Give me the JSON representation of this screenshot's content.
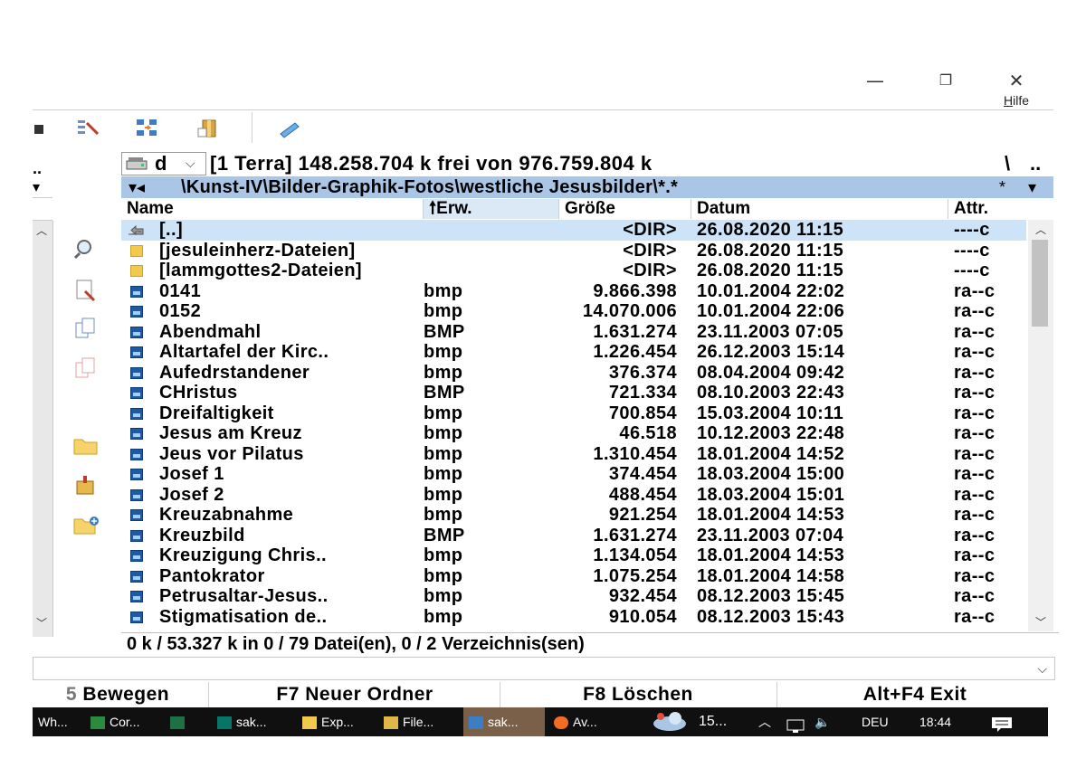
{
  "window": {
    "controls": {
      "minimize": "—",
      "restore": "❐",
      "close": "✕"
    },
    "menu_help": "Hilfe"
  },
  "toolbar": {
    "icons": [
      "toolbar-icon-partial",
      "multi-rename-icon",
      "sync-dirs-icon",
      "pack-files-icon",
      "notepad-icon"
    ]
  },
  "drive": {
    "letter": "d",
    "info": "[1 Terra]  148.258.704 k frei von 976.759.804 k",
    "root": "\\",
    "up": ".."
  },
  "path": {
    "arrows": "▾◂",
    "text": "\\Kunst-IV\\Bilder-Graphik-Fotos\\westliche Jesusbilder\\*.*",
    "star": "*",
    "dropdown": "▾"
  },
  "columns": {
    "name": "Name",
    "ext": "Erw.",
    "ext_sort": "🠕",
    "size": "Größe",
    "date": "Datum",
    "attr": "Attr."
  },
  "files": [
    {
      "name": "[..]",
      "ext": "",
      "size": "<DIR>",
      "date": "26.08.2020 11:15",
      "attr": "----c",
      "type": "up",
      "selected": true
    },
    {
      "name": "[jesuleinherz-Dateien]",
      "ext": "",
      "size": "<DIR>",
      "date": "26.08.2020 11:15",
      "attr": "----c",
      "type": "dir"
    },
    {
      "name": "[lammgottes2-Dateien]",
      "ext": "",
      "size": "<DIR>",
      "date": "26.08.2020 11:15",
      "attr": "----c",
      "type": "dir"
    },
    {
      "name": "0141",
      "ext": "bmp",
      "size": "9.866.398",
      "date": "10.01.2004 22:02",
      "attr": "ra--c",
      "type": "img"
    },
    {
      "name": "0152",
      "ext": "bmp",
      "size": "14.070.006",
      "date": "10.01.2004 22:06",
      "attr": "ra--c",
      "type": "img"
    },
    {
      "name": "Abendmahl",
      "ext": "BMP",
      "size": "1.631.274",
      "date": "23.11.2003 07:05",
      "attr": "ra--c",
      "type": "img"
    },
    {
      "name": "Altartafel der Kirc..",
      "ext": "bmp",
      "size": "1.226.454",
      "date": "26.12.2003 15:14",
      "attr": "ra--c",
      "type": "img"
    },
    {
      "name": "Aufedrstandener",
      "ext": "bmp",
      "size": "376.374",
      "date": "08.04.2004 09:42",
      "attr": "ra--c",
      "type": "img"
    },
    {
      "name": "CHristus",
      "ext": "BMP",
      "size": "721.334",
      "date": "08.10.2003 22:43",
      "attr": "ra--c",
      "type": "img"
    },
    {
      "name": "Dreifaltigkeit",
      "ext": "bmp",
      "size": "700.854",
      "date": "15.03.2004 10:11",
      "attr": "ra--c",
      "type": "img"
    },
    {
      "name": "Jesus am Kreuz",
      "ext": "bmp",
      "size": "46.518",
      "date": "10.12.2003 22:48",
      "attr": "ra--c",
      "type": "img"
    },
    {
      "name": "Jeus vor Pilatus",
      "ext": "bmp",
      "size": "1.310.454",
      "date": "18.01.2004 14:52",
      "attr": "ra--c",
      "type": "img"
    },
    {
      "name": "Josef 1",
      "ext": "bmp",
      "size": "374.454",
      "date": "18.03.2004 15:00",
      "attr": "ra--c",
      "type": "img"
    },
    {
      "name": "Josef 2",
      "ext": "bmp",
      "size": "488.454",
      "date": "18.03.2004 15:01",
      "attr": "ra--c",
      "type": "img"
    },
    {
      "name": "Kreuzabnahme",
      "ext": "bmp",
      "size": "921.254",
      "date": "18.01.2004 14:53",
      "attr": "ra--c",
      "type": "img"
    },
    {
      "name": "Kreuzbild",
      "ext": "BMP",
      "size": "1.631.274",
      "date": "23.11.2003 07:04",
      "attr": "ra--c",
      "type": "img"
    },
    {
      "name": "Kreuzigung Chris..",
      "ext": "bmp",
      "size": "1.134.054",
      "date": "18.01.2004 14:53",
      "attr": "ra--c",
      "type": "img"
    },
    {
      "name": "Pantokrator",
      "ext": "bmp",
      "size": "1.075.254",
      "date": "18.01.2004 14:58",
      "attr": "ra--c",
      "type": "img"
    },
    {
      "name": "Petrusaltar-Jesus..",
      "ext": "bmp",
      "size": "932.454",
      "date": "08.12.2003 15:45",
      "attr": "ra--c",
      "type": "img"
    },
    {
      "name": "Stigmatisation de..",
      "ext": "bmp",
      "size": "910.054",
      "date": "08.12.2003 15:43",
      "attr": "ra--c",
      "type": "img"
    }
  ],
  "status": "0 k / 53.327 k in 0 / 79 Datei(en), 0 / 2 Verzeichnis(sen)",
  "fkeys": [
    "Bewegen",
    "F7 Neuer Ordner",
    "F8 Löschen",
    "Alt+F4 Exit"
  ],
  "taskbar": {
    "items": [
      "Wh...",
      "Cor...",
      "",
      "sak...",
      "Exp...",
      "File...",
      "sak...",
      "Av..."
    ],
    "weather": "15...",
    "language": "DEU",
    "time": "18:44"
  }
}
